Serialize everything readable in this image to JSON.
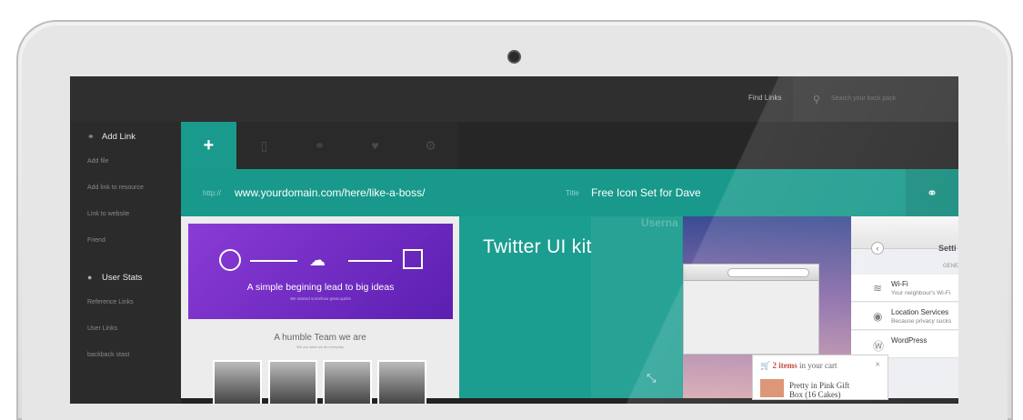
{
  "topbar": {
    "find_links": "Find Links",
    "search_placeholder": "Search your back pack"
  },
  "sidebar": {
    "sections": [
      {
        "title": "Add Link",
        "icon": "link-icon",
        "items": [
          "Add file",
          "Add link to resource",
          "Link to website",
          "Friend"
        ]
      },
      {
        "title": "User Stats",
        "icon": "user-icon",
        "items": [
          "Reference Links",
          "User Links",
          "backback stast"
        ]
      }
    ]
  },
  "tabs": [
    {
      "icon": "plus-icon",
      "glyph": "+"
    },
    {
      "icon": "document-icon",
      "glyph": "▯"
    },
    {
      "icon": "link-icon",
      "glyph": "⚭"
    },
    {
      "icon": "heart-icon",
      "glyph": "♥"
    },
    {
      "icon": "gear-icon",
      "glyph": "⚙"
    }
  ],
  "url": {
    "label": "http://",
    "value": "www.yourdomain.com/here/like-a-boss/",
    "title_label": "Title",
    "title_value": "Free Icon Set for Dave"
  },
  "card1": {
    "headline": "A simple begining lead to big ideas",
    "sub": "We started somehow great quirks",
    "team_title": "A humble Team we are",
    "team_sub": "We are what we do everyday"
  },
  "card2": {
    "title": "Twitter UI kit",
    "ghost_user": "Userna"
  },
  "cart": {
    "count": "2 items",
    "rest": " in your cart",
    "item_line1": "Pretty in Pink Gift",
    "item_line2": "Box (16 Cakes)",
    "close": "×"
  },
  "settings": {
    "title": "Setti",
    "general": "GENE",
    "rows": [
      {
        "icon": "wifi-icon",
        "glyph": "≋",
        "title": "Wi-Fi",
        "sub": "Your neighbour's Wi-Fi"
      },
      {
        "icon": "location-icon",
        "glyph": "◉",
        "title": "Location Services",
        "sub": "Because privacy sucks"
      },
      {
        "icon": "wordpress-icon",
        "glyph": "Ⓦ",
        "title": "WordPress",
        "sub": ""
      }
    ]
  },
  "colors": {
    "accent": "#1a9a8c",
    "purple": "#7a30cc"
  }
}
